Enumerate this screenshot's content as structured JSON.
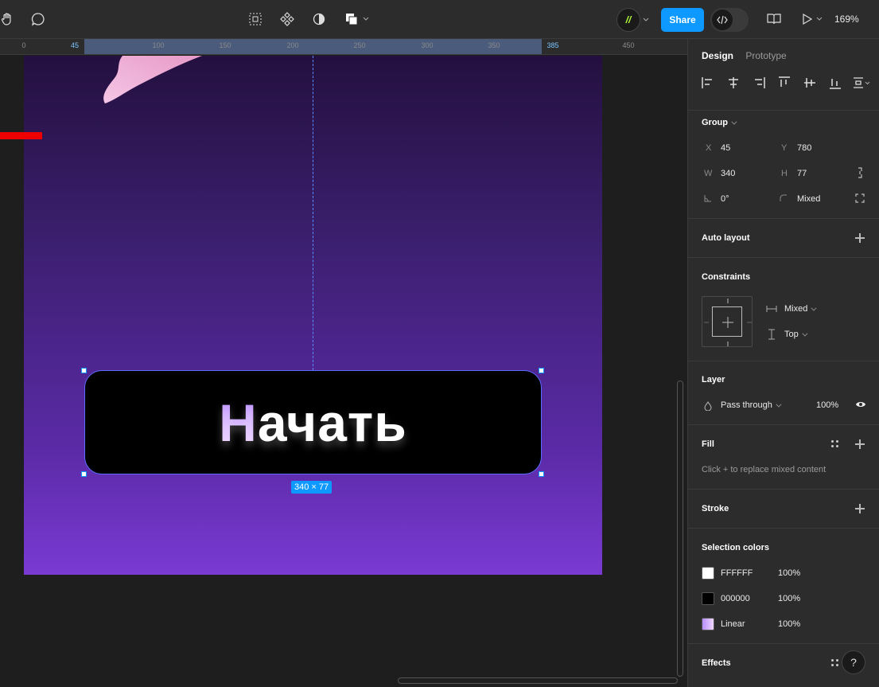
{
  "toolbar": {
    "share_label": "Share",
    "zoom": "169%",
    "avatar_text": "//"
  },
  "ruler": {
    "ticks": [
      "0",
      "45",
      "100",
      "150",
      "200",
      "250",
      "300",
      "350",
      "385",
      "450"
    ]
  },
  "canvas": {
    "button_text_first": "Н",
    "button_text_rest": "ачать",
    "dimension_badge": "340 × 77"
  },
  "panel": {
    "tabs": [
      "Design",
      "Prototype"
    ],
    "group_title": "Group",
    "x_label": "X",
    "x_value": "45",
    "y_label": "Y",
    "y_value": "780",
    "w_label": "W",
    "w_value": "340",
    "h_label": "H",
    "h_value": "77",
    "rotation_value": "0°",
    "radius_value": "Mixed",
    "auto_layout": "Auto layout",
    "constraints": "Constraints",
    "constraint_h": "Mixed",
    "constraint_v": "Top",
    "layer": "Layer",
    "blend": "Pass through",
    "opacity": "100%",
    "fill": "Fill",
    "fill_hint": "Click + to replace mixed content",
    "stroke": "Stroke",
    "selection_colors": "Selection colors",
    "colors": [
      {
        "name": "FFFFFF",
        "opacity": "100%",
        "hex": "#ffffff"
      },
      {
        "name": "000000",
        "opacity": "100%",
        "hex": "#000000"
      },
      {
        "name": "Linear",
        "opacity": "100%",
        "hex": "#c8a6ff"
      }
    ],
    "effects": "Effects"
  },
  "help": "?"
}
